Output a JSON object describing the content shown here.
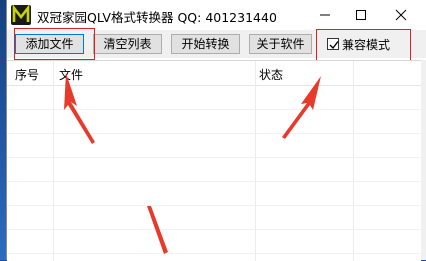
{
  "window": {
    "title": "双冠家园QLV格式转换器 QQ: 401231440",
    "app_icon_letter": "M",
    "controls": {
      "minimize": "minimize-icon",
      "maximize": "maximize-icon",
      "close": "close-icon"
    }
  },
  "toolbar": {
    "add_file": "添加文件",
    "clear_list": "清空列表",
    "start_convert": "开始转换",
    "about": "关于软件",
    "compat_mode": {
      "label": "兼容模式",
      "checked": true
    }
  },
  "list": {
    "columns": [
      "序号",
      "文件",
      "状态"
    ],
    "rows": []
  },
  "annotations": {
    "highlight_color": "#e02020"
  },
  "colors": {
    "desktop": "#1e4f9a",
    "button_face": "#e1e1e1",
    "focus_border": "#0078d7"
  }
}
